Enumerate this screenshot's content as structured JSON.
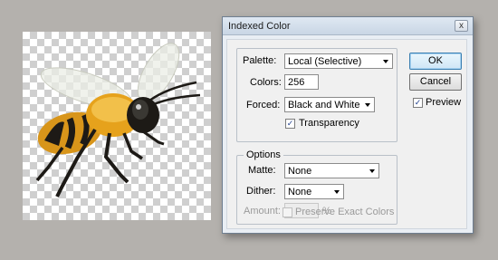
{
  "dialog": {
    "title": "Indexed Color",
    "close_glyph": "x",
    "palette": {
      "label": "Palette:",
      "value": "Local (Selective)"
    },
    "colors": {
      "label": "Colors:",
      "value": "256"
    },
    "forced": {
      "label": "Forced:",
      "value": "Black and White"
    },
    "transparency": {
      "label": "Transparency",
      "checked": true
    },
    "options": {
      "group_title": "Options",
      "matte": {
        "label": "Matte:",
        "value": "None"
      },
      "dither": {
        "label": "Dither:",
        "value": "None"
      },
      "amount": {
        "label": "Amount:",
        "value": "",
        "unit": "%"
      },
      "preserve": {
        "label": "Preserve Exact Colors",
        "checked": false
      }
    },
    "buttons": {
      "ok": "OK",
      "cancel": "Cancel"
    },
    "preview": {
      "label": "Preview",
      "checked": true
    }
  },
  "canvas": {
    "content": "bee-illustration",
    "background": "transparency-checkerboard"
  },
  "icons": {
    "check": "✓",
    "close": "close-icon"
  },
  "colors": {
    "accent": "#3c7fb1",
    "bee_yellow": "#e6a21c",
    "bee_dark": "#1d1a16"
  }
}
